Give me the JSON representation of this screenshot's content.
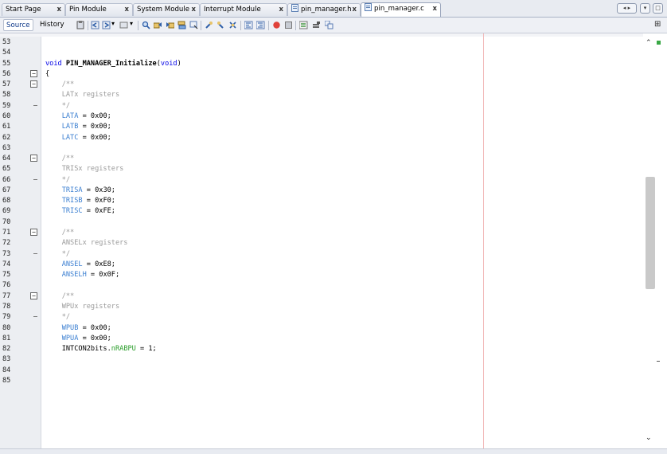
{
  "tabs": [
    {
      "label": "Start Page",
      "close": "x"
    },
    {
      "label": "Pin Module",
      "close": "x"
    },
    {
      "label": "System Module",
      "close": "x"
    },
    {
      "label": "Interrupt Module",
      "close": "x"
    },
    {
      "label": "pin_manager.h",
      "close": "x"
    },
    {
      "label": "pin_manager.c",
      "close": "x"
    }
  ],
  "tab_controls": {
    "nav": "◂ ▸",
    "list": "▾",
    "max": "□"
  },
  "toolbar": {
    "source_label": "Source",
    "history_label": "History",
    "expand_glyph": "⊞",
    "icons": [
      "last-edit-icon",
      "back-icon",
      "forward-icon",
      "find-icon",
      "find-previous-icon",
      "find-next-icon",
      "find-selection-icon",
      "toggle-highlight-icon",
      "toggle-rect-select-icon",
      "previous-bookmark-icon",
      "next-bookmark-icon",
      "toggle-bookmark-icon",
      "shift-left-icon",
      "shift-right-icon",
      "start-macro-icon",
      "stop-macro-icon",
      "comment-icon",
      "uncomment-icon",
      "diff-icon"
    ]
  },
  "editor": {
    "lines": [
      {
        "num": "53",
        "tokens": []
      },
      {
        "num": "54",
        "tokens": []
      },
      {
        "num": "55",
        "tokens": [
          {
            "t": "kw",
            "v": "void "
          },
          {
            "t": "fn",
            "v": "PIN_MANAGER_Initialize"
          },
          {
            "t": "op",
            "v": "("
          },
          {
            "t": "kw",
            "v": "void"
          },
          {
            "t": "op",
            "v": ")"
          }
        ]
      },
      {
        "num": "56",
        "fold": "minus",
        "tokens": [
          {
            "t": "op",
            "v": "{"
          }
        ]
      },
      {
        "num": "57",
        "fold": "minus",
        "tokens": [
          {
            "t": "cm",
            "v": "    /**"
          }
        ]
      },
      {
        "num": "58",
        "tokens": [
          {
            "t": "cm",
            "v": "    LATx registers"
          }
        ]
      },
      {
        "num": "59",
        "fold": "end",
        "tokens": [
          {
            "t": "cm",
            "v": "    */"
          }
        ]
      },
      {
        "num": "60",
        "tokens": [
          {
            "t": "var",
            "v": "    LATA"
          },
          {
            "t": "op",
            "v": " = 0x00;"
          }
        ]
      },
      {
        "num": "61",
        "tokens": [
          {
            "t": "var",
            "v": "    LATB"
          },
          {
            "t": "op",
            "v": " = 0x00;"
          }
        ]
      },
      {
        "num": "62",
        "tokens": [
          {
            "t": "var",
            "v": "    LATC"
          },
          {
            "t": "op",
            "v": " = 0x00;"
          }
        ]
      },
      {
        "num": "63",
        "tokens": []
      },
      {
        "num": "64",
        "fold": "minus",
        "tokens": [
          {
            "t": "cm",
            "v": "    /**"
          }
        ]
      },
      {
        "num": "65",
        "tokens": [
          {
            "t": "cm",
            "v": "    TRISx registers"
          }
        ]
      },
      {
        "num": "66",
        "fold": "end",
        "tokens": [
          {
            "t": "cm",
            "v": "    */"
          }
        ]
      },
      {
        "num": "67",
        "tokens": [
          {
            "t": "var",
            "v": "    TRISA"
          },
          {
            "t": "op",
            "v": " = 0x30;"
          }
        ]
      },
      {
        "num": "68",
        "tokens": [
          {
            "t": "var",
            "v": "    TRISB"
          },
          {
            "t": "op",
            "v": " = 0xF0;"
          }
        ]
      },
      {
        "num": "69",
        "tokens": [
          {
            "t": "var",
            "v": "    TRISC"
          },
          {
            "t": "op",
            "v": " = 0xFE;"
          }
        ]
      },
      {
        "num": "70",
        "tokens": []
      },
      {
        "num": "71",
        "fold": "minus",
        "tokens": [
          {
            "t": "cm",
            "v": "    /**"
          }
        ]
      },
      {
        "num": "72",
        "tokens": [
          {
            "t": "cm",
            "v": "    ANSELx registers"
          }
        ]
      },
      {
        "num": "73",
        "fold": "end",
        "tokens": [
          {
            "t": "cm",
            "v": "    */"
          }
        ]
      },
      {
        "num": "74",
        "tokens": [
          {
            "t": "var",
            "v": "    ANSEL"
          },
          {
            "t": "op",
            "v": " = 0xE8;"
          }
        ]
      },
      {
        "num": "75",
        "tokens": [
          {
            "t": "var",
            "v": "    ANSELH"
          },
          {
            "t": "op",
            "v": " = 0x0F;"
          }
        ]
      },
      {
        "num": "76",
        "tokens": []
      },
      {
        "num": "77",
        "fold": "minus",
        "tokens": [
          {
            "t": "cm",
            "v": "    /**"
          }
        ]
      },
      {
        "num": "78",
        "tokens": [
          {
            "t": "cm",
            "v": "    WPUx registers"
          }
        ]
      },
      {
        "num": "79",
        "fold": "end",
        "tokens": [
          {
            "t": "cm",
            "v": "    */"
          }
        ]
      },
      {
        "num": "80",
        "tokens": [
          {
            "t": "var",
            "v": "    WPUB"
          },
          {
            "t": "op",
            "v": " = 0x00;"
          }
        ]
      },
      {
        "num": "81",
        "tokens": [
          {
            "t": "var",
            "v": "    WPUA"
          },
          {
            "t": "op",
            "v": " = 0x00;"
          }
        ]
      },
      {
        "num": "82",
        "tokens": [
          {
            "t": "op",
            "v": "    INTCON2bits."
          },
          {
            "t": "fld",
            "v": "nRABPU"
          },
          {
            "t": "op",
            "v": " = 1;"
          }
        ]
      },
      {
        "num": "83",
        "tokens": []
      },
      {
        "num": "84",
        "tokens": []
      },
      {
        "num": "85",
        "tokens": []
      }
    ]
  },
  "scrollbar": {
    "up": "⌃",
    "down": "⌄",
    "position_fraction": 0.47
  }
}
